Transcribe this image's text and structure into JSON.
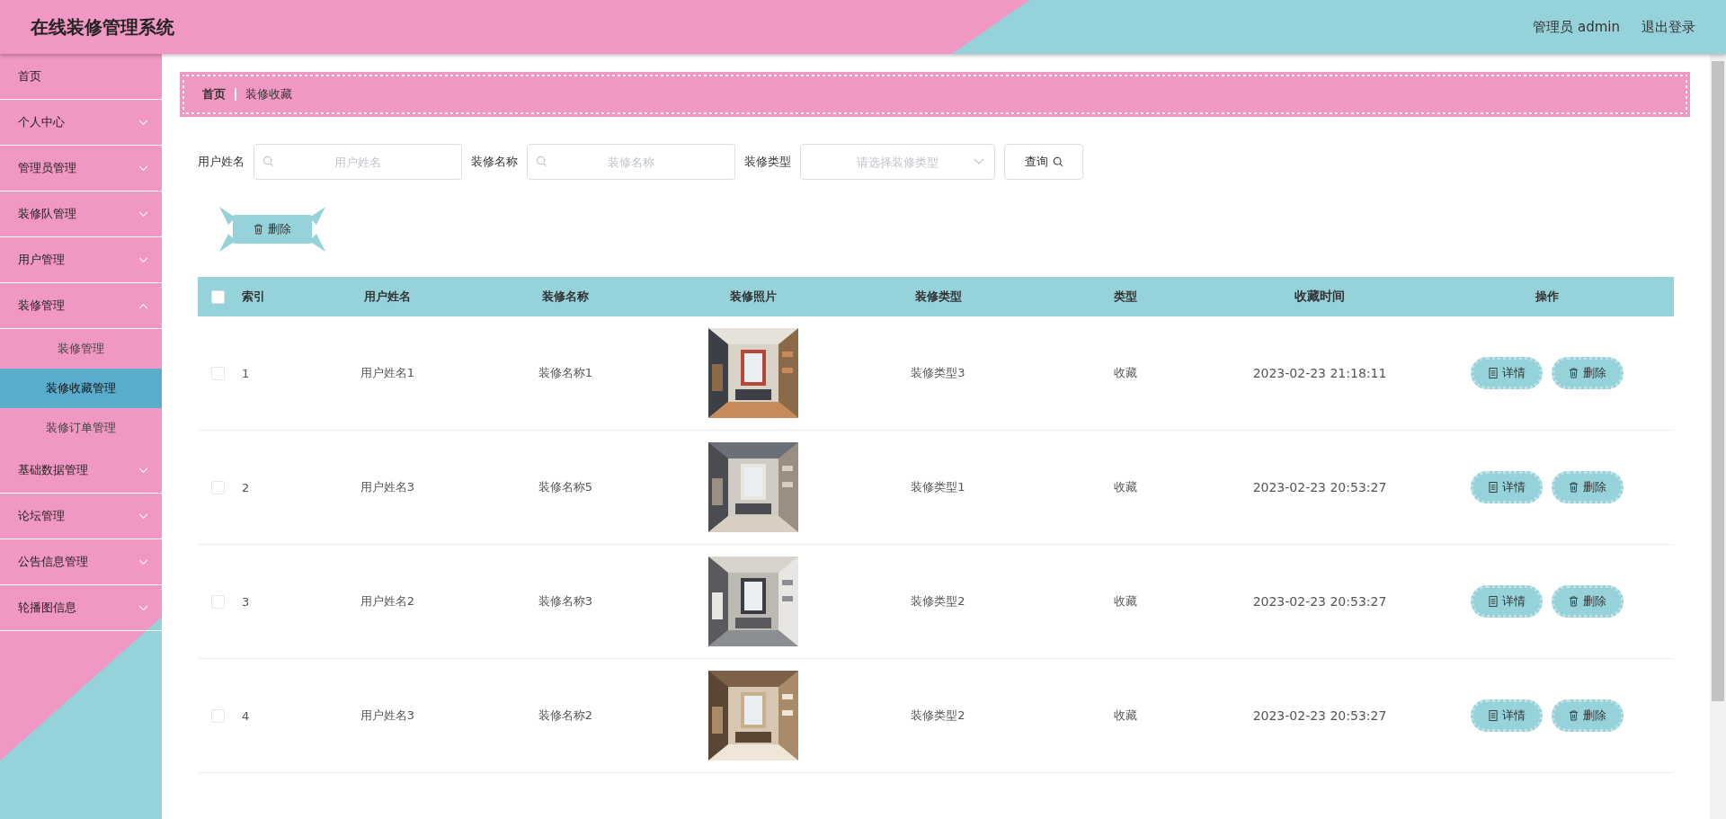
{
  "header": {
    "title": "在线装修管理系统",
    "user": "管理员 admin",
    "logout": "退出登录"
  },
  "sidebar": {
    "items": [
      {
        "label": "首页",
        "kind": "link"
      },
      {
        "label": "个人中心",
        "kind": "menu",
        "expanded": false
      },
      {
        "label": "管理员管理",
        "kind": "menu",
        "expanded": false
      },
      {
        "label": "装修队管理",
        "kind": "menu",
        "expanded": false
      },
      {
        "label": "用户管理",
        "kind": "menu",
        "expanded": false
      },
      {
        "label": "装修管理",
        "kind": "menu",
        "expanded": true,
        "children": [
          {
            "label": "装修管理",
            "selected": false
          },
          {
            "label": "装修收藏管理",
            "selected": true
          },
          {
            "label": "装修订单管理",
            "selected": false
          }
        ]
      },
      {
        "label": "基础数据管理",
        "kind": "menu",
        "expanded": false
      },
      {
        "label": "论坛管理",
        "kind": "menu",
        "expanded": false
      },
      {
        "label": "公告信息管理",
        "kind": "menu",
        "expanded": false
      },
      {
        "label": "轮播图信息",
        "kind": "menu",
        "expanded": false
      }
    ]
  },
  "breadcrumb": [
    "首页",
    "装修收藏"
  ],
  "search": {
    "fields": [
      {
        "label": "用户姓名",
        "placeholder": "用户姓名",
        "kind": "input"
      },
      {
        "label": "装修名称",
        "placeholder": "装修名称",
        "kind": "input"
      },
      {
        "label": "装修类型",
        "placeholder": "请选择装修类型",
        "kind": "select"
      }
    ],
    "button": "查询"
  },
  "toolbar": {
    "delete": "删除"
  },
  "table": {
    "all_checked": false,
    "columns": [
      "索引",
      "用户姓名",
      "装修名称",
      "装修照片",
      "装修类型",
      "类型",
      "收藏时间",
      "操作"
    ],
    "rows": [
      {
        "checked": false,
        "index": "1",
        "user": "用户姓名1",
        "name": "装修名称1",
        "type": "装修类型3",
        "kind": "收藏",
        "time": "2023-02-23 21:18:11",
        "actions": [
          "详情",
          "删除"
        ]
      },
      {
        "checked": false,
        "index": "2",
        "user": "用户姓名3",
        "name": "装修名称5",
        "type": "装修类型1",
        "kind": "收藏",
        "time": "2023-02-23 20:53:27",
        "actions": [
          "详情",
          "删除"
        ]
      },
      {
        "checked": false,
        "index": "3",
        "user": "用户姓名2",
        "name": "装修名称3",
        "type": "装修类型2",
        "kind": "收藏",
        "time": "2023-02-23 20:53:27",
        "actions": [
          "详情",
          "删除"
        ]
      },
      {
        "checked": false,
        "index": "4",
        "user": "用户姓名3",
        "name": "装修名称2",
        "type": "装修类型2",
        "kind": "收藏",
        "time": "2023-02-23 20:53:27",
        "actions": [
          "详情",
          "删除"
        ]
      }
    ]
  }
}
